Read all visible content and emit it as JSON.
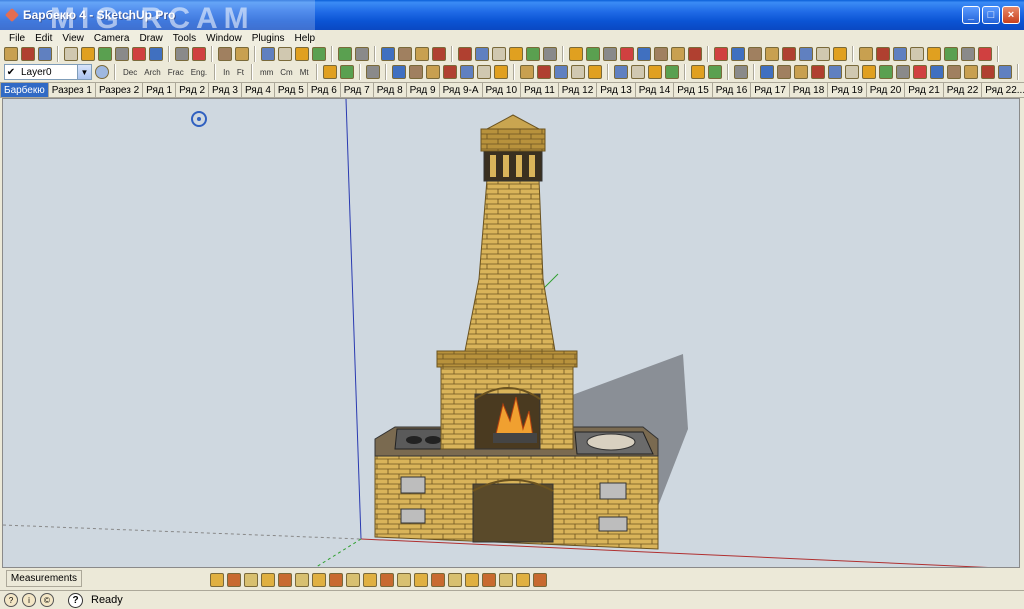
{
  "window": {
    "title": "Барбекю 4 - SketchUp Pro",
    "watermark": "MIG·RCAM"
  },
  "menu": [
    "File",
    "Edit",
    "View",
    "Camera",
    "Draw",
    "Tools",
    "Window",
    "Plugins",
    "Help"
  ],
  "toolbar2": {
    "layer": "Layer0",
    "units_style": [
      "Dec",
      "Arch",
      "Frac",
      "Eng."
    ],
    "units_imperial": [
      "In",
      "Ft"
    ],
    "units_metric": [
      "mm",
      "Cm",
      "Mt"
    ]
  },
  "tabs": [
    "Барбекю",
    "Разрез 1",
    "Разрез 2",
    "Ряд 1",
    "Ряд 2",
    "Ряд 3",
    "Ряд 4",
    "Ряд 5",
    "Ряд 6",
    "Ряд 7",
    "Ряд 8",
    "Ряд 9",
    "Ряд 9-А",
    "Ряд 10",
    "Ряд 11",
    "Ряд 12",
    "Ряд 13",
    "Ряд 14",
    "Ряд 15",
    "Ряд 16",
    "Ряд 17",
    "Ряд 18",
    "Ряд 19",
    "Ряд 20",
    "Ряд 21",
    "Ряд 22",
    "Ряд 22..."
  ],
  "active_tab": 0,
  "status": {
    "measurements_label": "Measurements",
    "text": "Ready"
  },
  "colors": {
    "brick": "#d9b45a",
    "mortar": "#6b5320",
    "sky": "#cfd8e0",
    "axis_red": "#b03030",
    "axis_blue": "#2a3ab0",
    "axis_green": "#30a030"
  }
}
